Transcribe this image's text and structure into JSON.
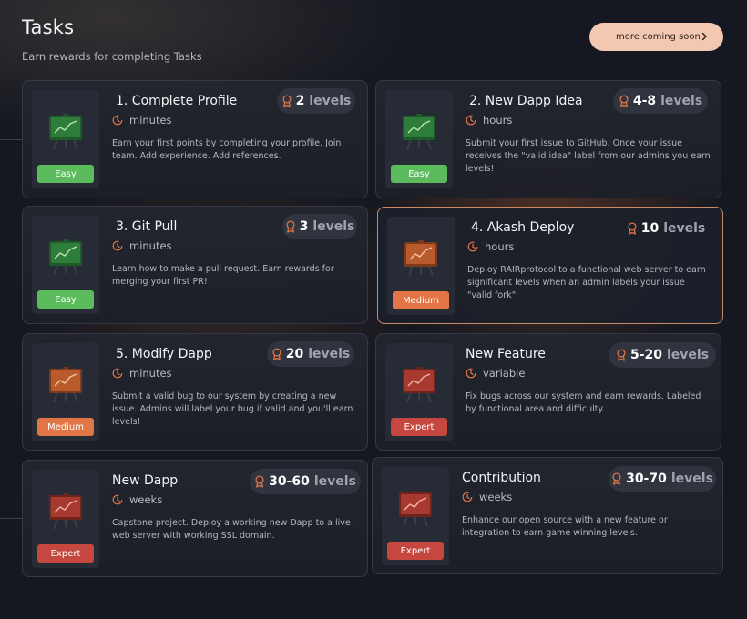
{
  "header": {
    "title": "Tasks",
    "subtitle": "Earn rewards for completing Tasks",
    "more_button": "more coming soon"
  },
  "levels_word": "levels",
  "colors": {
    "accent": "#e27545",
    "easy": "#5bbb5d",
    "medium": "#e27545",
    "expert": "#c5473f",
    "button_bg": "#f3c8b3"
  },
  "tasks": [
    {
      "title": "1. Complete Profile",
      "time": "minutes",
      "levels": "2",
      "difficulty": "Easy",
      "board_icon": "green-chart-board-icon",
      "description": "Earn your first points by completing your profile. Join team. Add experience. Add references."
    },
    {
      "title": "2. New Dapp Idea",
      "time": "hours",
      "levels": "4-8",
      "difficulty": "Easy",
      "board_icon": "green-chart-board-icon",
      "description": "Submit your first issue to GitHub. Once your issue receives the \"valid idea\" label from our admins you earn levels!"
    },
    {
      "title": "3. Git Pull",
      "time": "minutes",
      "levels": "3",
      "difficulty": "Easy",
      "board_icon": "green-chart-board-icon",
      "description": "Learn how to make a pull request. Earn rewards for merging your first PR!"
    },
    {
      "title": "4. Akash Deploy",
      "time": "hours",
      "levels": "10",
      "difficulty": "Medium",
      "board_icon": "orange-chart-board-icon",
      "description": "Deploy RAIRprotocol to a functional web server to earn significant levels when an admin labels your issue \"valid fork\""
    },
    {
      "title": "5. Modify Dapp",
      "time": "minutes",
      "levels": "20",
      "difficulty": "Medium",
      "board_icon": "orange-chart-board-icon",
      "description": "Submit a valid bug to our system by creating a new issue. Admins will label your bug if valid and you'll earn levels!"
    },
    {
      "title": "New Feature",
      "time": "variable",
      "levels": "5-20",
      "difficulty": "Expert",
      "board_icon": "red-chart-board-icon",
      "description": "Fix bugs across our system and earn rewards. Labeled by functional area and difficulty."
    },
    {
      "title": "New Dapp",
      "time": "weeks",
      "levels": "30-60",
      "difficulty": "Expert",
      "board_icon": "red-chart-board-icon",
      "description": "Capstone project. Deploy a working new Dapp to a live web server with working SSL domain."
    },
    {
      "title": "Contribution",
      "time": "weeks",
      "levels": "30-70",
      "difficulty": "Expert",
      "board_icon": "red-chart-board-icon",
      "description": "Enhance our open source with a new feature or integration to earn game winning levels."
    }
  ]
}
